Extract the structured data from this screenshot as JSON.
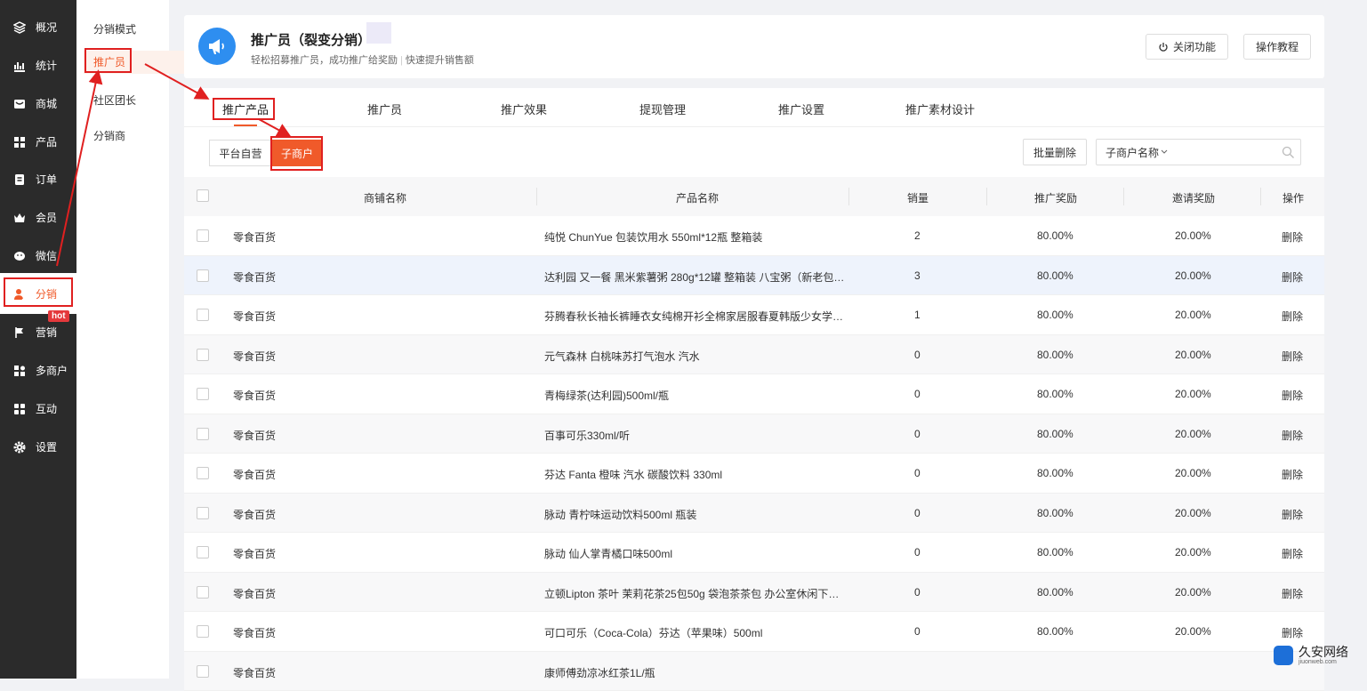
{
  "sidebar": {
    "items": [
      {
        "label": "概况",
        "icon": "layers-icon"
      },
      {
        "label": "统计",
        "icon": "chart-icon"
      },
      {
        "label": "商城",
        "icon": "store-icon"
      },
      {
        "label": "产品",
        "icon": "grid-icon"
      },
      {
        "label": "订单",
        "icon": "order-icon"
      },
      {
        "label": "会员",
        "icon": "crown-icon"
      },
      {
        "label": "微信",
        "icon": "wechat-icon"
      },
      {
        "label": "分销",
        "icon": "distribution-icon"
      },
      {
        "label": "营销",
        "icon": "flag-icon"
      },
      {
        "label": "多商户",
        "icon": "merchant-icon"
      },
      {
        "label": "互动",
        "icon": "apps-icon"
      },
      {
        "label": "设置",
        "icon": "gear-icon"
      }
    ],
    "hot_badge": "hot"
  },
  "subnav": {
    "items": [
      "分销模式",
      "推广员",
      "社区团长",
      "分销商"
    ]
  },
  "header": {
    "title": "推广员（裂变分销）",
    "subtitle_a": "轻松招募推广员，成功推广给奖励",
    "subtitle_b": "快速提升销售额",
    "btn_close": "关闭功能",
    "btn_tutorial": "操作教程"
  },
  "tabs": [
    "推广产品",
    "推广员",
    "推广效果",
    "提现管理",
    "推广设置",
    "推广素材设计"
  ],
  "segments": [
    "平台自营",
    "子商户"
  ],
  "toolbar": {
    "batch_delete": "批量删除",
    "search_placeholder": "子商户名称"
  },
  "table": {
    "headers": [
      "商铺名称",
      "产品名称",
      "销量",
      "推广奖励",
      "邀请奖励",
      "操作"
    ],
    "rows": [
      {
        "store": "零食百货",
        "product": "纯悦 ChunYue 包装饮用水 550ml*12瓶 整箱装",
        "sales": "2",
        "promo": "80.00%",
        "invite": "20.00%",
        "op": "删除"
      },
      {
        "store": "零食百货",
        "product": "达利园 又一餐 黑米紫薯粥 280g*12罐 整箱装 八宝粥（新老包装…",
        "sales": "3",
        "promo": "80.00%",
        "invite": "20.00%",
        "op": "删除"
      },
      {
        "store": "零食百货",
        "product": "芬腾春秋长袖长裤睡衣女纯棉开衫全棉家居服春夏韩版少女学生…",
        "sales": "1",
        "promo": "80.00%",
        "invite": "20.00%",
        "op": "删除"
      },
      {
        "store": "零食百货",
        "product": "元气森林 白桃味苏打气泡水 汽水",
        "sales": "0",
        "promo": "80.00%",
        "invite": "20.00%",
        "op": "删除"
      },
      {
        "store": "零食百货",
        "product": "青梅绿茶(达利园)500ml/瓶",
        "sales": "0",
        "promo": "80.00%",
        "invite": "20.00%",
        "op": "删除"
      },
      {
        "store": "零食百货",
        "product": "百事可乐330ml/听",
        "sales": "0",
        "promo": "80.00%",
        "invite": "20.00%",
        "op": "删除"
      },
      {
        "store": "零食百货",
        "product": "芬达 Fanta 橙味 汽水 碳酸饮料 330ml",
        "sales": "0",
        "promo": "80.00%",
        "invite": "20.00%",
        "op": "删除"
      },
      {
        "store": "零食百货",
        "product": "脉动 青柠味运动饮料500ml 瓶装",
        "sales": "0",
        "promo": "80.00%",
        "invite": "20.00%",
        "op": "删除"
      },
      {
        "store": "零食百货",
        "product": "脉动 仙人掌青橘口味500ml",
        "sales": "0",
        "promo": "80.00%",
        "invite": "20.00%",
        "op": "删除"
      },
      {
        "store": "零食百货",
        "product": "立顿Lipton 茶叶 茉莉花茶25包50g 袋泡茶茶包 办公室休闲下午…",
        "sales": "0",
        "promo": "80.00%",
        "invite": "20.00%",
        "op": "删除"
      },
      {
        "store": "零食百货",
        "product": "可口可乐（Coca-Cola）芬达（苹果味）500ml",
        "sales": "0",
        "promo": "80.00%",
        "invite": "20.00%",
        "op": "删除"
      },
      {
        "store": "零食百货",
        "product": "康师傅劲凉冰红茶1L/瓶",
        "sales": "",
        "promo": "",
        "invite": "",
        "op": ""
      }
    ]
  },
  "watermark": {
    "name": "久安网络",
    "url": "jiuonweb.com"
  },
  "colors": {
    "accent": "#f05a2a",
    "sidebar": "#2b2b2b",
    "annotation": "#e02020"
  }
}
